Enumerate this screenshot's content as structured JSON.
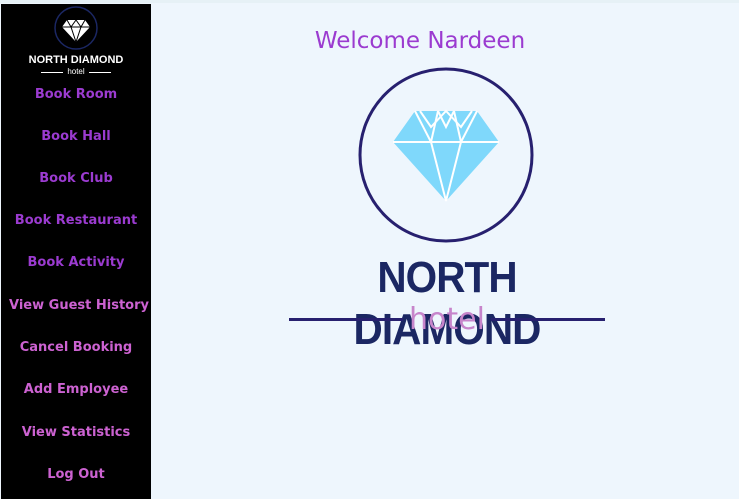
{
  "welcome": "Welcome Nardeen",
  "brand": {
    "name": "NORTH DIAMOND",
    "sub": "hotel"
  },
  "sidebar": {
    "items": [
      {
        "label": "Book Room"
      },
      {
        "label": "Book Hall"
      },
      {
        "label": "Book Club"
      },
      {
        "label": "Book Restaurant"
      },
      {
        "label": "Book Activity"
      },
      {
        "label": "View Guest History"
      },
      {
        "label": "Cancel Booking"
      },
      {
        "label": "Add Employee"
      },
      {
        "label": "View Statistics"
      },
      {
        "label": "Log Out"
      }
    ]
  },
  "colors": {
    "accent_purple": "#9b3bd0",
    "accent_pink": "#cc62d1",
    "logo_navy": "#1b2763",
    "diamond": "#7fd8fb"
  },
  "icons": {
    "logo": "diamond-icon"
  }
}
